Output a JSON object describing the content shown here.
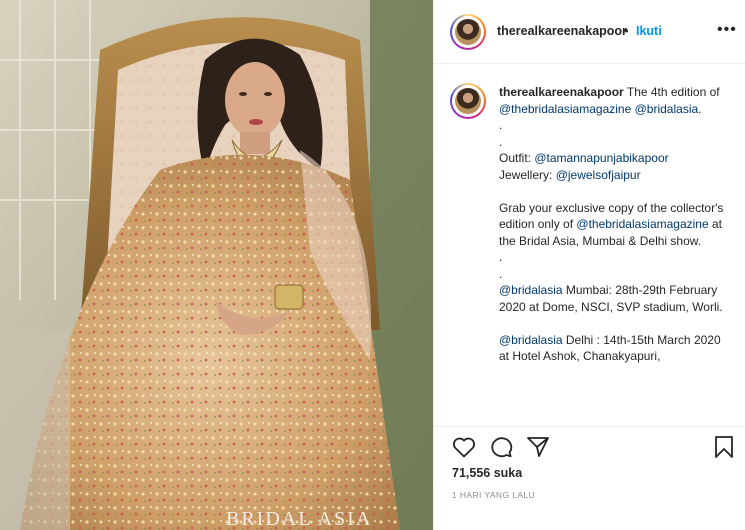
{
  "post": {
    "image": {
      "description_icon": "photo-icon",
      "watermark": "BRIDAL ASIA"
    },
    "header": {
      "username": "therealkareenakapoor",
      "separator": "•",
      "follow_label": "Ikuti",
      "more_icon": "more-options-icon",
      "more_label": "•••"
    },
    "caption": {
      "username": "therealkareenakapoor",
      "lines": [
        {
          "parts": [
            {
              "t": "The 4th edition of ",
              "k": "text"
            },
            {
              "t": "@thebridalasiamagazine",
              "k": "mention"
            },
            {
              "t": " ",
              "k": "text"
            },
            {
              "t": "@bridalasia",
              "k": "mention"
            },
            {
              "t": ".",
              "k": "text"
            }
          ]
        },
        {
          "parts": [
            {
              "t": ".",
              "k": "text"
            }
          ]
        },
        {
          "parts": [
            {
              "t": ".",
              "k": "text"
            }
          ]
        },
        {
          "parts": [
            {
              "t": "Outfit: ",
              "k": "text"
            },
            {
              "t": "@tamannapunjabikapoor",
              "k": "mention"
            }
          ]
        },
        {
          "parts": [
            {
              "t": "Jewellery: ",
              "k": "text"
            },
            {
              "t": "@jewelsofjaipur",
              "k": "mention"
            }
          ]
        },
        {
          "parts": [
            {
              "t": "",
              "k": "text"
            }
          ]
        },
        {
          "parts": [
            {
              "t": "Grab your exclusive copy of the collector's edition only of ",
              "k": "text"
            },
            {
              "t": "@thebridalasiamagazine",
              "k": "mention"
            },
            {
              "t": " at the Bridal Asia, Mumbai & Delhi show.",
              "k": "text"
            }
          ]
        },
        {
          "parts": [
            {
              "t": ".",
              "k": "text"
            }
          ]
        },
        {
          "parts": [
            {
              "t": ".",
              "k": "text"
            }
          ]
        },
        {
          "parts": [
            {
              "t": "@bridalasia",
              "k": "mention"
            },
            {
              "t": " Mumbai: 28th-29th February 2020 at Dome, NSCI, SVP stadium, Worli.",
              "k": "text"
            }
          ]
        },
        {
          "parts": [
            {
              "t": "",
              "k": "text"
            }
          ]
        },
        {
          "parts": [
            {
              "t": "@bridalasia",
              "k": "mention"
            },
            {
              "t": " Delhi : 14th-15th March 2020 at Hotel Ashok, Chanakyapuri,",
              "k": "text"
            }
          ]
        }
      ]
    },
    "actions": {
      "like_icon": "heart-icon",
      "comment_icon": "comment-icon",
      "share_icon": "share-icon",
      "save_icon": "bookmark-icon"
    },
    "likes_text": "71,556 suka",
    "timestamp": "1 HARI YANG LALU"
  }
}
